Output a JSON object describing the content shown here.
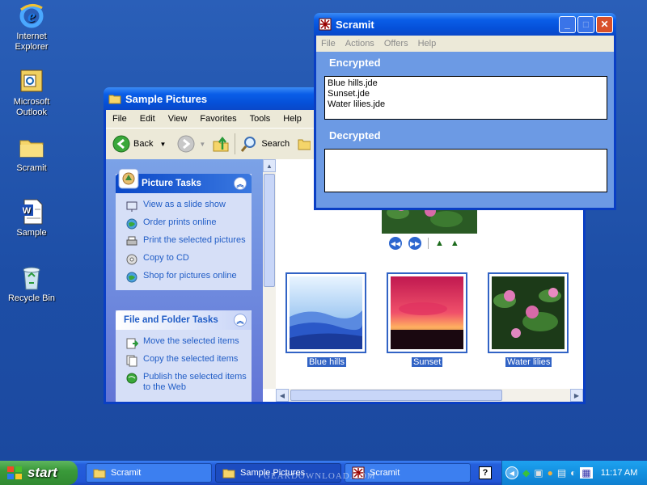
{
  "desktop": {
    "icons": [
      {
        "label": "Internet Explorer",
        "icon": "internet-explorer-icon"
      },
      {
        "label": "Microsoft Outlook",
        "icon": "outlook-icon"
      },
      {
        "label": "Scramit",
        "icon": "folder-icon"
      },
      {
        "label": "Sample",
        "icon": "word-document-icon"
      },
      {
        "label": "Recycle Bin",
        "icon": "recycle-bin-icon"
      }
    ]
  },
  "explorer": {
    "title": "Sample Pictures",
    "menu": [
      "File",
      "Edit",
      "View",
      "Favorites",
      "Tools",
      "Help"
    ],
    "toolbar": {
      "back": "Back",
      "search": "Search"
    },
    "picture_tasks": {
      "title": "Picture Tasks",
      "items": [
        "View as a slide show",
        "Order prints online",
        "Print the selected pictures",
        "Copy to CD",
        "Shop for pictures online"
      ]
    },
    "file_tasks": {
      "title": "File and Folder Tasks",
      "items": [
        "Move the selected items",
        "Copy the selected items",
        "Publish the selected items to the Web"
      ]
    },
    "thumbnails": [
      "Blue hills",
      "Sunset",
      "Water lilies"
    ]
  },
  "scramit": {
    "title": "Scramit",
    "menu": [
      "File",
      "Actions",
      "Offers",
      "Help"
    ],
    "encrypted_label": "Encrypted",
    "encrypted_files": [
      "Blue hills.jde",
      "Sunset.jde",
      "Water lilies.jde"
    ],
    "decrypted_label": "Decrypted",
    "decrypted_files": []
  },
  "taskbar": {
    "start": "start",
    "buttons": [
      "Scramit",
      "Sample Pictures",
      "Scramit"
    ],
    "clock": "11:17 AM"
  },
  "watermark": "GEARDOWNLOAD.COM",
  "colors": {
    "title_blue": "#0a5ee8",
    "task_link": "#215dc6",
    "scramit_body": "#6c9ae4",
    "start_green": "#3a9a3a"
  }
}
